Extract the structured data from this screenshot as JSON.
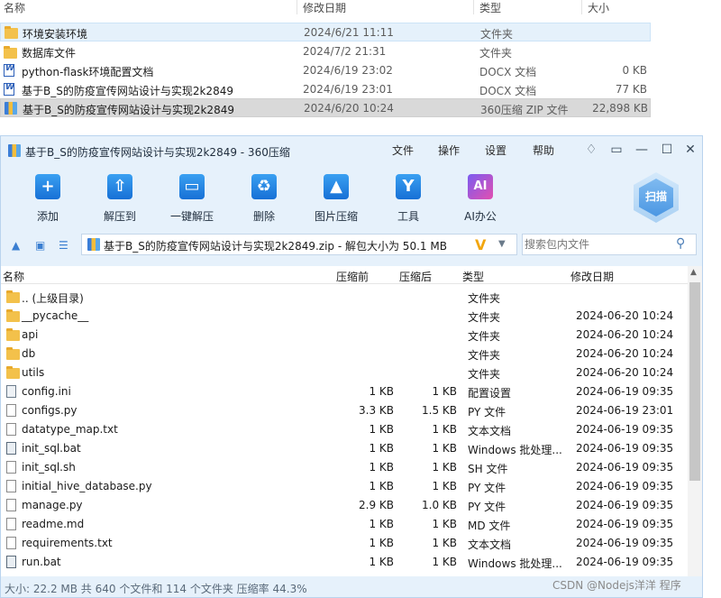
{
  "explorer": {
    "headers": {
      "name": "名称",
      "date": "修改日期",
      "type": "类型",
      "size": "大小"
    },
    "rows": [
      {
        "name": "环境安装环境",
        "date": "2024/6/21 11:11",
        "type": "文件夹",
        "size": ""
      },
      {
        "name": "数据库文件",
        "date": "2024/7/2 21:31",
        "type": "文件夹",
        "size": ""
      },
      {
        "name": "python-flask环境配置文档",
        "date": "2024/6/19 23:02",
        "type": "DOCX 文档",
        "size": "0 KB"
      },
      {
        "name": "基于B_S的防疫宣传网站设计与实现2k2849",
        "date": "2024/6/19 23:01",
        "type": "DOCX 文档",
        "size": "77 KB"
      },
      {
        "name": "基于B_S的防疫宣传网站设计与实现2k2849",
        "date": "2024/6/20 10:24",
        "type": "360压缩 ZIP 文件",
        "size": "22,898 KB"
      }
    ]
  },
  "window": {
    "title": "基于B_S的防疫宣传网站设计与实现2k2849 - 360压缩",
    "menu": [
      "文件",
      "操作",
      "设置",
      "帮助"
    ],
    "controls": {
      "minimize": "—",
      "maximize": "☐",
      "close": "✕"
    }
  },
  "toolbar": {
    "buttons": [
      {
        "label": "添加",
        "glyph": "+"
      },
      {
        "label": "解压到",
        "glyph": "⇧"
      },
      {
        "label": "一键解压",
        "glyph": "▭"
      },
      {
        "label": "删除",
        "glyph": "♻"
      },
      {
        "label": "图片压缩",
        "glyph": "▲"
      },
      {
        "label": "工具",
        "glyph": "Y"
      },
      {
        "label": "AI办公",
        "glyph": "AI"
      }
    ],
    "scan_label": "扫描"
  },
  "address": {
    "path": "基于B_S的防疫宣传网站设计与实现2k2849.zip - 解包大小为 50.1 MB",
    "v_badge": "V",
    "search_placeholder": "搜索包内文件"
  },
  "filelist": {
    "headers": {
      "name": "名称",
      "compressed": "压缩前",
      "after": "压缩后",
      "type": "类型",
      "date": "修改日期"
    },
    "rows": [
      {
        "name": ".. (上级目录)",
        "before": "",
        "after": "",
        "type": "文件夹",
        "date": "",
        "icon": "folder"
      },
      {
        "name": "__pycache__",
        "before": "",
        "after": "",
        "type": "文件夹",
        "date": "2024-06-20 10:24",
        "icon": "folder"
      },
      {
        "name": "api",
        "before": "",
        "after": "",
        "type": "文件夹",
        "date": "2024-06-20 10:24",
        "icon": "folder"
      },
      {
        "name": "db",
        "before": "",
        "after": "",
        "type": "文件夹",
        "date": "2024-06-20 10:24",
        "icon": "folder"
      },
      {
        "name": "utils",
        "before": "",
        "after": "",
        "type": "文件夹",
        "date": "2024-06-20 10:24",
        "icon": "folder"
      },
      {
        "name": "config.ini",
        "before": "1 KB",
        "after": "1 KB",
        "type": "配置设置",
        "date": "2024-06-19 09:35",
        "icon": "cfg"
      },
      {
        "name": "configs.py",
        "before": "3.3 KB",
        "after": "1.5 KB",
        "type": "PY 文件",
        "date": "2024-06-19 23:01",
        "icon": "file"
      },
      {
        "name": "datatype_map.txt",
        "before": "1 KB",
        "after": "1 KB",
        "type": "文本文档",
        "date": "2024-06-19 09:35",
        "icon": "file"
      },
      {
        "name": "init_sql.bat",
        "before": "1 KB",
        "after": "1 KB",
        "type": "Windows 批处理...",
        "date": "2024-06-19 09:35",
        "icon": "bat"
      },
      {
        "name": "init_sql.sh",
        "before": "1 KB",
        "after": "1 KB",
        "type": "SH 文件",
        "date": "2024-06-19 09:35",
        "icon": "file"
      },
      {
        "name": "initial_hive_database.py",
        "before": "1 KB",
        "after": "1 KB",
        "type": "PY 文件",
        "date": "2024-06-19 09:35",
        "icon": "file"
      },
      {
        "name": "manage.py",
        "before": "2.9 KB",
        "after": "1.0 KB",
        "type": "PY 文件",
        "date": "2024-06-19 09:35",
        "icon": "file"
      },
      {
        "name": "readme.md",
        "before": "1 KB",
        "after": "1 KB",
        "type": "MD 文件",
        "date": "2024-06-19 09:35",
        "icon": "file"
      },
      {
        "name": "requirements.txt",
        "before": "1 KB",
        "after": "1 KB",
        "type": "文本文档",
        "date": "2024-06-19 09:35",
        "icon": "file"
      },
      {
        "name": "run.bat",
        "before": "1 KB",
        "after": "1 KB",
        "type": "Windows 批处理...",
        "date": "2024-06-19 09:35",
        "icon": "bat"
      }
    ]
  },
  "status": "大小: 22.2 MB 共 640 个文件和 114 个文件夹 压缩率 44.3%",
  "watermark": "CSDN @Nodejs洋洋   程序"
}
